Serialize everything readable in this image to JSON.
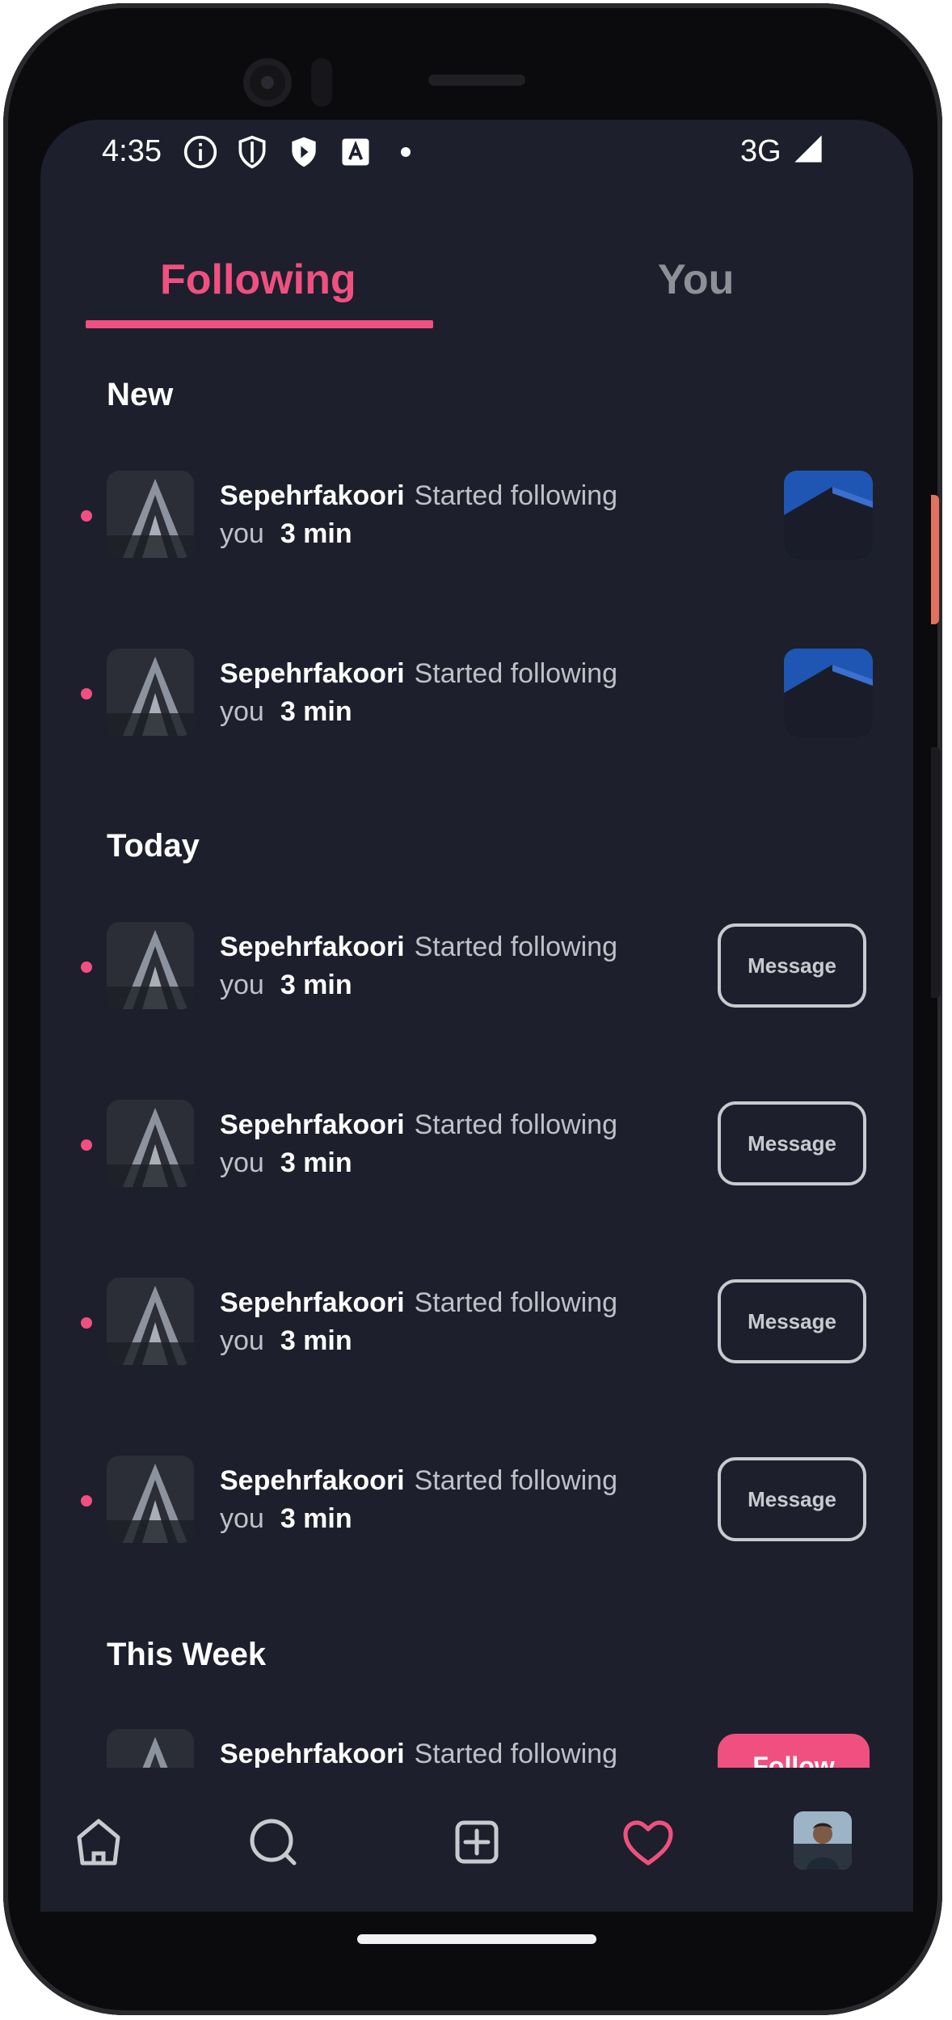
{
  "status_bar": {
    "time": "4:35",
    "network": "3G",
    "icons": [
      "info-icon",
      "shield-icon",
      "play-shield-icon",
      "text-a-icon",
      "dot-icon",
      "signal-icon"
    ]
  },
  "tabs": [
    {
      "label": "Following",
      "active": true
    },
    {
      "label": "You",
      "active": false
    }
  ],
  "sections": {
    "new": "New",
    "today": "Today",
    "this_week": "This Week"
  },
  "notifications": {
    "new": [
      {
        "name": "Sepehrfakoori",
        "action": "Started following you",
        "time": "3 min",
        "trailing": "post-thumbnail",
        "unread": true
      },
      {
        "name": "Sepehrfakoori",
        "action": "Started following you",
        "time": "3 min",
        "trailing": "post-thumbnail",
        "unread": true
      }
    ],
    "today": [
      {
        "name": "Sepehrfakoori",
        "action": "Started following you",
        "time": "3 min",
        "button": "Message",
        "unread": true
      },
      {
        "name": "Sepehrfakoori",
        "action": "Started following you",
        "time": "3 min",
        "button": "Message",
        "unread": true
      },
      {
        "name": "Sepehrfakoori",
        "action": "Started following you",
        "time": "3 min",
        "button": "Message",
        "unread": true
      },
      {
        "name": "Sepehrfakoori",
        "action": "Started following you",
        "time": "3 min",
        "button": "Message",
        "unread": true
      }
    ],
    "this_week": [
      {
        "name": "Sepehrfakoori",
        "action": "Started following",
        "button": "Follow",
        "unread": true
      }
    ]
  },
  "bottom_nav": {
    "items": [
      "home-icon",
      "search-icon",
      "add-icon",
      "heart-icon",
      "profile-avatar"
    ],
    "active": "heart-icon"
  },
  "colors": {
    "accent": "#f0507f",
    "background": "#1d1f2c",
    "text_primary": "#ffffff",
    "text_secondary": "#bfc1c8",
    "tab_inactive": "#8f9097"
  }
}
